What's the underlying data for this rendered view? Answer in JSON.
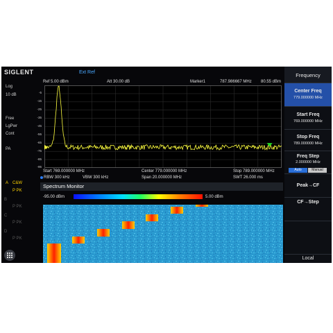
{
  "header": {
    "logo": "SIGLENT",
    "ext_ref": "Ext Ref"
  },
  "left_panel": {
    "scale": "Log",
    "scale_div": "10 dB",
    "trig": "Free",
    "lgpwr": "LgPwr",
    "cont": "Cont",
    "pa": "PA",
    "trace_a_label": "A",
    "trace_a_mode": "C&W",
    "trace_a_det": "P PK",
    "ghost": [
      "B",
      "P PK",
      "C",
      "P PK",
      "D",
      "P PK"
    ]
  },
  "plot_header": {
    "ref": "Ref   5.00 dBm",
    "att": "Att   30.00 dB",
    "marker_label": "Marker1",
    "marker_freq": "787.986667 MHz",
    "marker_level": "80.55 dBm"
  },
  "y_axis": {
    "labels": [
      "-5",
      "-15",
      "-25",
      "-35",
      "-45",
      "-55",
      "-65",
      "-75",
      "-85",
      "-95"
    ]
  },
  "plot_info": {
    "start": "Start  769.000000 MHz",
    "center": "Center  779.000000 MHz",
    "stop": "Stop  789.000000 MHz",
    "rbw": "RBW  300 kHz",
    "vbw": "VBW  300 kHz",
    "span": "Span   20.000000 MHz",
    "swt": "SWT  26.000 ms"
  },
  "spectrum_monitor": {
    "title": "Spectrum Monitor",
    "scale_min": "-95.00 dBm",
    "scale_max": "5.00 dBm"
  },
  "chart_data": {
    "type": "line",
    "x_unit": "MHz",
    "xlim": [
      769,
      789
    ],
    "ylim": [
      -100,
      0
    ],
    "peak": {
      "x": 770.2,
      "y": -1
    },
    "noise_floor": -75,
    "marker": {
      "x": 787.986667
    }
  },
  "softkeys": {
    "menu_title": "Frequency",
    "center_freq_label": "Center Freq",
    "center_freq_value": "779.000000 MHz",
    "start_freq_label": "Start Freq",
    "start_freq_value": "769.000000 MHz",
    "stop_freq_label": "Stop Freq",
    "stop_freq_value": "789.000000 MHz",
    "freq_step_label": "Freq Step",
    "freq_step_value": "2.000000 MHz",
    "auto": "Auto",
    "manual": "Manual",
    "peak_cf": "Peak→CF",
    "cf_step": "CF→Step",
    "local": "Local"
  },
  "colors": {
    "trace": "#ffff40",
    "accent": "#2450a8",
    "marker": "#22dd22"
  }
}
